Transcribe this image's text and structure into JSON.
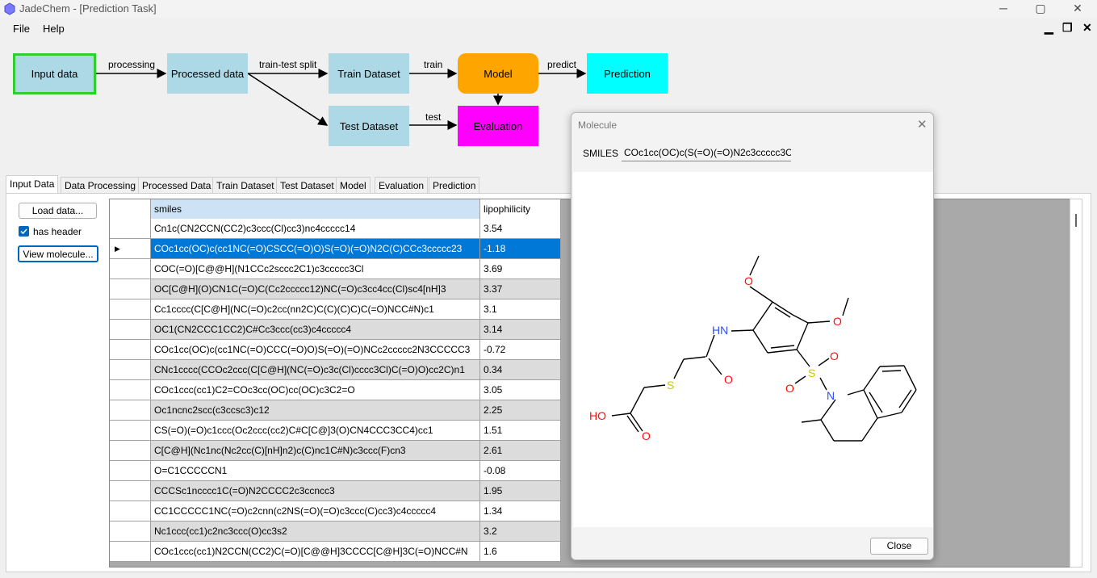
{
  "window": {
    "title": "JadeChem - [Prediction Task]",
    "controls": {
      "minimize": "─",
      "maximize": "▢",
      "close": "✕"
    }
  },
  "menu": {
    "items": [
      "File",
      "Help"
    ],
    "mdi_controls": {
      "minimize": "▁",
      "restore": "❐",
      "close": "✕"
    }
  },
  "workflow": {
    "nodes": {
      "input": "Input data",
      "processed": "Processed data",
      "train": "Train Dataset",
      "test": "Test Dataset",
      "model": "Model",
      "prediction": "Prediction",
      "evaluation": "Evaluation"
    },
    "edges": {
      "processing": "processing",
      "split": "train-test split",
      "train": "train",
      "test": "test",
      "predict": "predict"
    },
    "colors": {
      "data": "#add8e6",
      "model": "#ffa500",
      "prediction": "#00ffff",
      "evaluation": "#ff00ff",
      "selected_border": "#32cd32"
    }
  },
  "tabs": [
    "Input Data",
    "Data Processing",
    "Processed Data",
    "Train Dataset",
    "Test Dataset",
    "Model",
    "Evaluation",
    "Prediction"
  ],
  "input_panel": {
    "load_button": "Load data...",
    "has_header_label": "has header",
    "has_header_checked": true,
    "view_molecule_button": "View molecule..."
  },
  "table": {
    "columns": [
      "smiles",
      "lipophilicity"
    ],
    "selected_row_marker": "▶",
    "selected_row": 1,
    "rows": [
      [
        "Cn1c(CN2CCN(CC2)c3ccc(Cl)cc3)nc4ccccc14",
        "3.54"
      ],
      [
        "COc1cc(OC)c(cc1NC(=O)CSCC(=O)O)S(=O)(=O)N2C(C)CCc3ccccc23",
        "-1.18"
      ],
      [
        "COC(=O)[C@@H](N1CCc2sccc2C1)c3ccccc3Cl",
        "3.69"
      ],
      [
        "OC[C@H](O)CN1C(=O)C(Cc2ccccc12)NC(=O)c3cc4cc(Cl)sc4[nH]3",
        "3.37"
      ],
      [
        "Cc1cccc(C[C@H](NC(=O)c2cc(nn2C)C(C)(C)C)C(=O)NCC#N)c1",
        "3.1"
      ],
      [
        "OC1(CN2CCC1CC2)C#Cc3ccc(cc3)c4ccccc4",
        "3.14"
      ],
      [
        "COc1cc(OC)c(cc1NC(=O)CCC(=O)O)S(=O)(=O)NCc2ccccc2N3CCCCC3",
        "-0.72"
      ],
      [
        "CNc1cccc(CCOc2ccc(C[C@H](NC(=O)c3c(Cl)cccc3Cl)C(=O)O)cc2C)n1",
        "0.34"
      ],
      [
        "COc1ccc(cc1)C2=COc3cc(OC)cc(OC)c3C2=O",
        "3.05"
      ],
      [
        "Oc1ncnc2scc(c3ccsc3)c12",
        "2.25"
      ],
      [
        "CS(=O)(=O)c1ccc(Oc2ccc(cc2)C#C[C@]3(O)CN4CCC3CC4)cc1",
        "1.51"
      ],
      [
        "C[C@H](Nc1nc(Nc2cc(C)[nH]n2)c(C)nc1C#N)c3ccc(F)cn3",
        "2.61"
      ],
      [
        "O=C1CCCCCN1",
        "-0.08"
      ],
      [
        "CCCSc1ncccc1C(=O)N2CCCC2c3ccncc3",
        "1.95"
      ],
      [
        "CC1CCCCC1NC(=O)c2cnn(c2NS(=O)(=O)c3ccc(C)cc3)c4ccccc4",
        "1.34"
      ],
      [
        "Nc1ccc(cc1)c2nc3ccc(O)cc3s2",
        "3.2"
      ],
      [
        "COc1ccc(cc1)N2CCN(CC2)C(=O)[C@@H]3CCCC[C@H]3C(=O)NCC#N",
        "1.6"
      ]
    ]
  },
  "dialog": {
    "title": "Molecule",
    "smiles_label": "SMILES",
    "smiles_value": "COc1cc(OC)c(S(=O)(=O)N2c3ccccc3C",
    "close_button": "Close",
    "atom_labels": {
      "o_methoxy1": "O",
      "o_methoxy2": "O",
      "amide_n": "HN",
      "amide_o": "O",
      "sulfur_thio": "S",
      "sulfonyl_s": "S",
      "sulfonyl_o1": "O",
      "sulfonyl_o2": "O",
      "ring_n": "N",
      "acid_oh": "HO",
      "acid_o": "O"
    },
    "colors": {
      "oxygen": "#ff0d0d",
      "nitrogen": "#3050f8",
      "sulfur": "#c8c800",
      "bond": "#000000"
    }
  }
}
